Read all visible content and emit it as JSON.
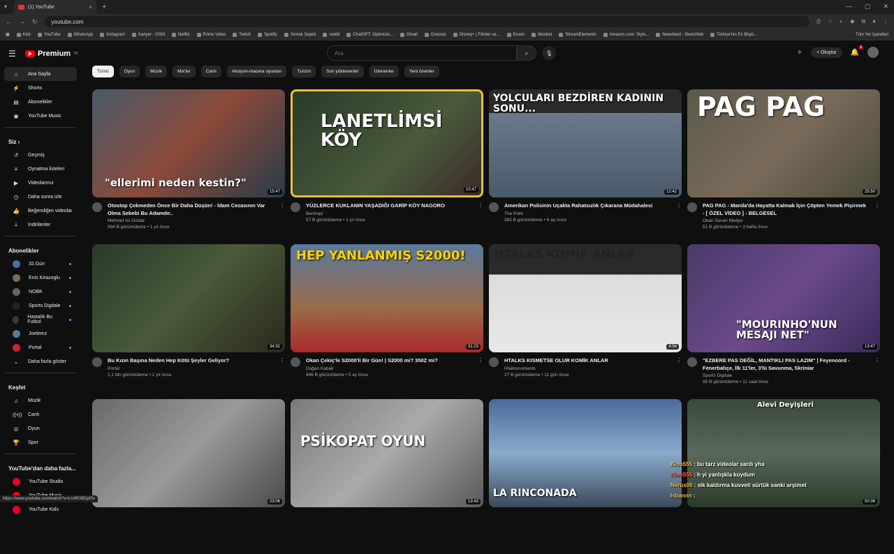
{
  "browser": {
    "tab_title": "(1) YouTube",
    "url": "youtube.com",
    "status_url": "https://www.youtube.com/watch?v=LU4RXB1pf0s",
    "bookmarks": [
      "Kick",
      "YouTube",
      "WhatsApp",
      "Instagram",
      "Kariyer - OSM",
      "Netflix",
      "Prime Video",
      "Twitch",
      "Spotify",
      "Yemek Sepeti",
      "reddit",
      "ChatGPT: Optimizin...",
      "Gmail",
      "Gnoosic",
      "Disney+ | Filmler ve...",
      "Exxen",
      "Moobot",
      "StreamElements",
      "Amazon.com: Stylo...",
      "Newsfeed - Sketchfab",
      "Türkiye'nin En Büyü..."
    ],
    "all_bookmarks": "Tüm Yer İşaretleri"
  },
  "header": {
    "logo_text": "Premium",
    "logo_region": "TR",
    "search_placeholder": "Ara",
    "create_label": "Oluştur",
    "notif_count": "1"
  },
  "sidebar": {
    "main": [
      {
        "label": "Ana Sayfa",
        "icon": "home-icon",
        "glyph": "⌂"
      },
      {
        "label": "Shorts",
        "icon": "shorts-icon",
        "glyph": "⚡"
      },
      {
        "label": "Abonelikler",
        "icon": "subscriptions-icon",
        "glyph": "▤"
      },
      {
        "label": "YouTube Music",
        "icon": "music-icon",
        "glyph": "◉"
      }
    ],
    "you_section": "Siz",
    "you": [
      {
        "label": "Geçmiş",
        "icon": "history-icon",
        "glyph": "↺"
      },
      {
        "label": "Oynatma listeleri",
        "icon": "playlist-icon",
        "glyph": "≡"
      },
      {
        "label": "Videolarınız",
        "icon": "your-videos-icon",
        "glyph": "▶"
      },
      {
        "label": "Daha sonra izle",
        "icon": "watch-later-icon",
        "glyph": "◷"
      },
      {
        "label": "Beğendiğim videolar",
        "icon": "like-icon",
        "glyph": "👍"
      },
      {
        "label": "İndirilenler",
        "icon": "download-icon",
        "glyph": "⤓"
      }
    ],
    "subs_section": "Abonelikler",
    "subs": [
      {
        "label": "32.Gün",
        "color": "#4a6fa5",
        "dot": true
      },
      {
        "label": "Enis Kirazoglu",
        "color": "#7a6a5a",
        "dot": true
      },
      {
        "label": "NOBK",
        "color": "#666666",
        "dot": true
      },
      {
        "label": "Sports Digitale",
        "color": "#222222",
        "dot": true
      },
      {
        "label": "Hastalık Bu Futbol",
        "color": "#3a3a3a",
        "dot": true
      },
      {
        "label": "Joelemz",
        "color": "#5a7a9a",
        "dot": false
      },
      {
        "label": "Portal",
        "color": "#cc2233",
        "dot": true
      }
    ],
    "show_more": "Daha fazla göster",
    "explore_section": "Keşfet",
    "explore": [
      {
        "label": "Müzik",
        "icon": "music-note-icon",
        "glyph": "♫"
      },
      {
        "label": "Canlı",
        "icon": "live-icon",
        "glyph": "((•))"
      },
      {
        "label": "Oyun",
        "icon": "gaming-icon",
        "glyph": "◎"
      },
      {
        "label": "Spor",
        "icon": "trophy-icon",
        "glyph": "🏆"
      }
    ],
    "more_section": "YouTube'dan daha fazla...",
    "more": [
      {
        "label": "YouTube Studio"
      },
      {
        "label": "YouTube Music"
      },
      {
        "label": "YouTube Kids"
      }
    ]
  },
  "chips": [
    "Tümü",
    "Oyun",
    "Müzik",
    "Mix'ler",
    "Canlı",
    "Aksiyon-macera oyunları",
    "Turizm",
    "Son yüklenenler",
    "İzlenenler",
    "Yeni öneriler"
  ],
  "videos": [
    {
      "title": "Otostop Çekmeden Önce Bir Daha Düşün! - İdam Cezasının Var Olma Sebebi Bu Adamdır..",
      "channel": "Mehmet Ali Güldal",
      "stats": "994 B görüntüleme • 1 yıl önce",
      "duration": "15:47",
      "thumb_text": "\"ellerimi neden kestin?\"",
      "bg": "linear-gradient(135deg,#4a5a6a,#8a4a3a 50%,#2a3a4a)"
    },
    {
      "title": "YÜZLERCE KUKLANIN YAŞADIĞI GARİP KÖY NAGORO",
      "channel": "Bentropi",
      "stats": "57 B görüntüleme • 1 yıl önce",
      "duration": "10:47",
      "thumb_text": "LANETLİMSİ KÖY",
      "bg": "linear-gradient(135deg,#2a3a2a,#4a5a3a 60%,#3a2a2a)"
    },
    {
      "title": "Amerikan Polisinin Uçakta Rahatsızlık Çıkarana Müdahalesi",
      "channel": "The Polis",
      "stats": "392 B görüntüleme • 6 ay önce",
      "duration": "12:42",
      "thumb_text": "YOLCULARI BEZDİREN KADININ SONU...",
      "bg": "linear-gradient(180deg,#2a2a2a 0%,#2a2a2a 22%,#6a7a8a 22%,#4a5a6a)"
    },
    {
      "title": "PAG PAG - Manila'da Hayatta Kalmak İçin Çöpten Yemek Pişirmek - [ ÖZEL VİDEO ] - BELGESEL",
      "channel": "Okan Suvari Medya",
      "stats": "51 B görüntüleme • 3 hafta önce",
      "duration": "25:50",
      "thumb_text": "PAG PAG",
      "bg": "linear-gradient(135deg,#5a5a4a,#7a6a5a 50%,#4a4a3a)"
    },
    {
      "title": "Bu Kızın Başına Neden Hep Kötü Şeyler Geliyor?",
      "channel": "Portal",
      "stats": "1,1 Mn görüntüleme • 1 yıl önce",
      "duration": "34:32",
      "thumb_text": "",
      "bg": "linear-gradient(135deg,#2a3a2a,#4a5a3a 50%,#2a2a1a)"
    },
    {
      "title": "Okan Çekiç'le S2000'li Bir Gün! | S2000 mi? 350Z mi?",
      "channel": "Doğan Kabak",
      "stats": "946 B görüntüleme • 5 ay önce",
      "duration": "31:23",
      "thumb_text": "HEP YANLANMIŞ S2000!",
      "bg": "linear-gradient(180deg,#5a7a9a,#9a6a4a 60%,#aa2a2a)"
    },
    {
      "title": "HTALKS KISMETSE OLUR KOMİK ANLAR",
      "channel": "Htalksmoments",
      "stats": "27 B görüntüleme • 11 gün önce",
      "duration": "8:56",
      "thumb_text": "HTALKS KOMİK ANLAR",
      "bg": "linear-gradient(180deg,#2a2a2a 0%,#2a2a2a 28%,#dcdcdc 28%,#e8e8e8)"
    },
    {
      "title": "\"EZBERE PAS DEĞİL, MANTIKLI PAS LAZIM\" | Feyenoord - Fenerbahçe, İlk 11'ler, 3'lü Savunma, Skriniar",
      "channel": "Sports Digitale",
      "stats": "95 B görüntüleme • 11 saat önce",
      "duration": "13:47",
      "thumb_text": "\"MOURINHO'NUN MESAJI NET\"",
      "bg": "linear-gradient(135deg,#4a3a6a,#6a4a8a 50%,#3a2a5a)"
    },
    {
      "title": "",
      "channel": "",
      "stats": "",
      "duration": "23:06",
      "thumb_text": "",
      "bg": "linear-gradient(135deg,#6a6a6a,#9a9a9a 50%,#4a4a4a)"
    },
    {
      "title": "",
      "channel": "",
      "stats": "",
      "duration": "13:43",
      "thumb_text": "PSİKOPAT OYUN",
      "bg": "linear-gradient(135deg,#7a7a7a,#aaa 50%,#5a5a5a)"
    },
    {
      "title": "",
      "channel": "",
      "stats": "",
      "duration": "",
      "thumb_text": "LA RINCONADA",
      "bg": "linear-gradient(180deg,#4a6a9a,#8aaacc 50%,#3a4a5a)"
    },
    {
      "title": "",
      "channel": "",
      "stats": "",
      "duration": "50:36",
      "thumb_text": "Alevi Deyişleri",
      "bg": "linear-gradient(180deg,#3a4a3a,#5a6a5a 50%,#2a3a2a)"
    }
  ],
  "chat": [
    {
      "user": "Kloo555",
      "msg": "bu tarz videolar sardı yha"
    },
    {
      "user": "Kloo555",
      "msg": "h yi yanlışkla koydum"
    },
    {
      "user": "Nerus06",
      "msg": "sik kaldırma kuvveti sürtük sanki arşimet"
    },
    {
      "user": "Isbannn",
      "msg": ""
    }
  ]
}
